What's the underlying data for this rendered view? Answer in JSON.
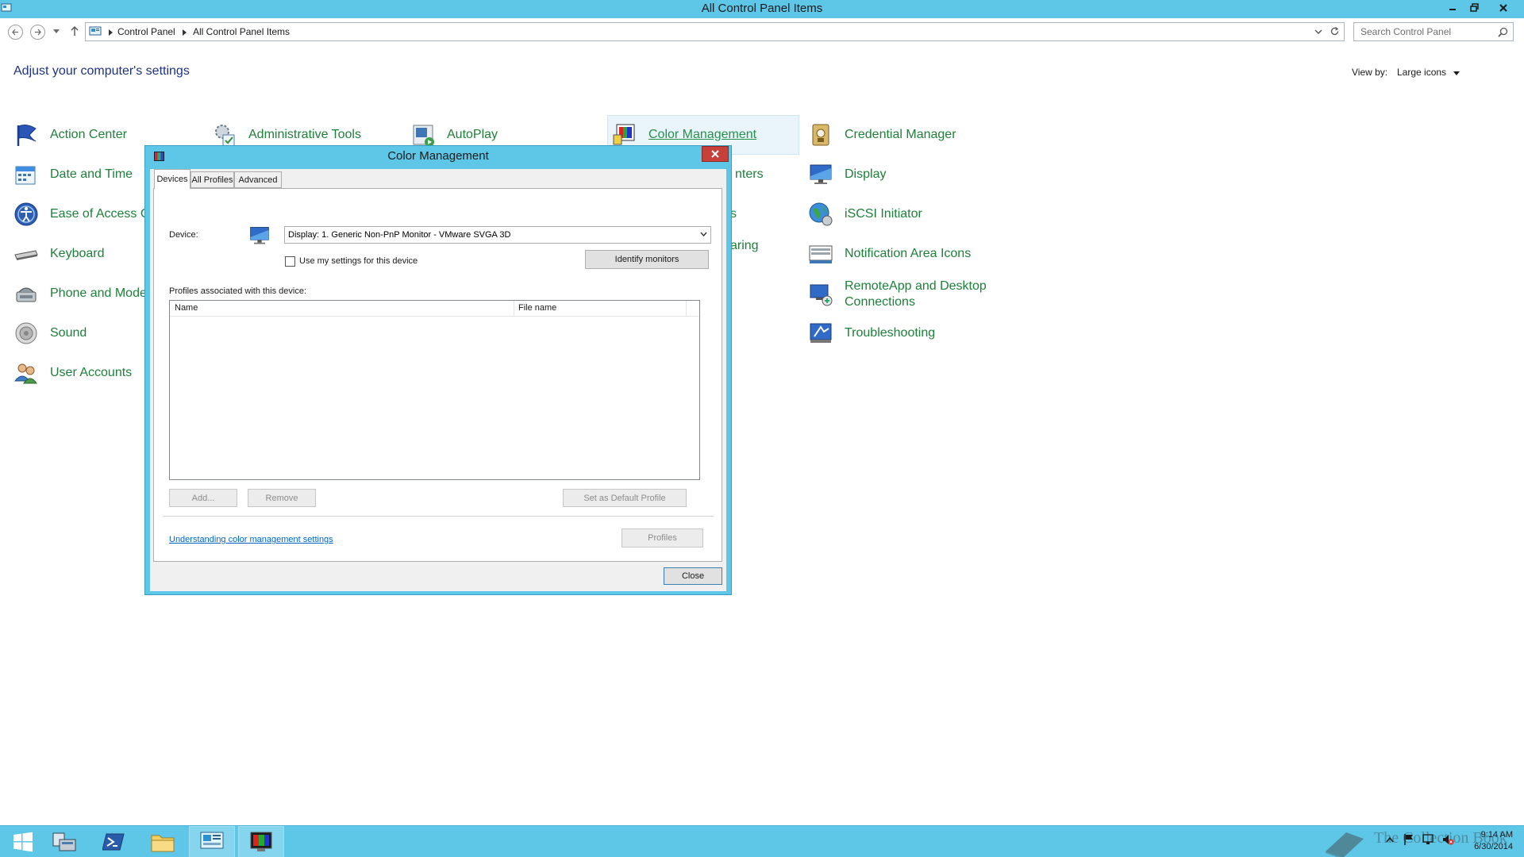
{
  "window": {
    "title": "All Control Panel Items"
  },
  "address_bar": {
    "breadcrumbs": [
      "Control Panel",
      "All Control Panel Items"
    ],
    "search_placeholder": "Search Control Panel"
  },
  "header": {
    "title": "Adjust your computer's settings",
    "view_by_label": "View by:",
    "view_by_value": "Large icons"
  },
  "items": [
    {
      "label": "Action Center",
      "icon": "action-center-flag-icon"
    },
    {
      "label": "Administrative Tools",
      "icon": "admin-tools-icon"
    },
    {
      "label": "AutoPlay",
      "icon": "autoplay-icon"
    },
    {
      "label": "Color Management",
      "icon": "color-management-icon"
    },
    {
      "label": "Credential Manager",
      "icon": "credential-manager-icon"
    },
    {
      "label": "Date and Time",
      "icon": "calendar-icon"
    },
    {
      "label": "Display",
      "icon": "monitor-icon"
    },
    {
      "label": "Ease of Access Ce",
      "icon": "ease-of-access-icon"
    },
    {
      "label": "iSCSI Initiator",
      "icon": "globe-icon"
    },
    {
      "label": "Keyboard",
      "icon": "keyboard-icon"
    },
    {
      "label": "Notification Area Icons",
      "icon": "notification-icon"
    },
    {
      "label": "Phone and Mode",
      "icon": "phone-modem-icon"
    },
    {
      "label": "RemoteApp and Desktop Connections",
      "label_line1": "RemoteApp and Desktop",
      "label_line2": "Connections",
      "icon": "remote-desktop-icon"
    },
    {
      "label": "Sound",
      "icon": "speaker-icon"
    },
    {
      "label": "Troubleshooting",
      "icon": "troubleshooting-icon"
    },
    {
      "label": "User Accounts",
      "icon": "users-icon"
    },
    {
      "label": "nters",
      "icon": "partial"
    },
    {
      "label": "s",
      "icon": "partial"
    },
    {
      "label": "aring",
      "icon": "partial"
    }
  ],
  "dialog": {
    "title": "Color Management",
    "tabs": [
      "Devices",
      "All Profiles",
      "Advanced"
    ],
    "device_label": "Device:",
    "device_value": "Display: 1. Generic Non-PnP Monitor - VMware SVGA 3D",
    "use_my_settings": "Use my settings for this device",
    "identify_button": "Identify monitors",
    "profiles_label": "Profiles associated with this device:",
    "columns": [
      "Name",
      "File name"
    ],
    "add_button": "Add...",
    "remove_button": "Remove",
    "set_default_button": "Set as Default Profile",
    "link": "Understanding color management settings",
    "profiles_button": "Profiles",
    "close_button": "Close"
  },
  "taskbar": {
    "time": "9:14 AM",
    "date": "6/30/2014",
    "watermark": "The Collection Book"
  },
  "colors": {
    "chrome": "#5ec6e6",
    "link_green": "#1e7f3a",
    "header_blue": "#1e3287"
  }
}
